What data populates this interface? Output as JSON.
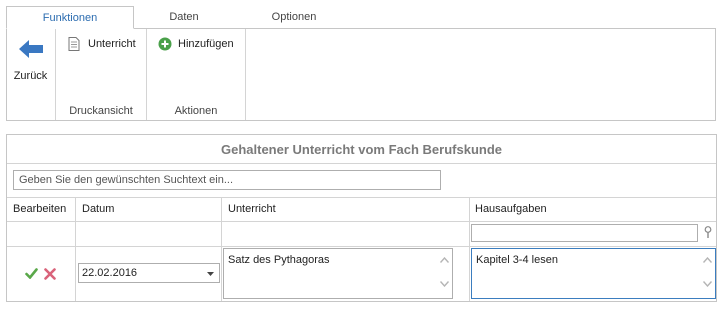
{
  "tabs": [
    {
      "label": "Funktionen",
      "active": true
    },
    {
      "label": "Daten",
      "active": false
    },
    {
      "label": "Optionen",
      "active": false
    }
  ],
  "ribbon": {
    "back_label": "Zurück",
    "print_group": {
      "button_label": "Unterricht",
      "group_label": "Druckansicht"
    },
    "actions_group": {
      "button_label": "Hinzufügen",
      "group_label": "Aktionen"
    }
  },
  "panel": {
    "title": "Gehaltener Unterricht vom Fach Berufskunde",
    "search_placeholder": "Geben Sie den gewünschten Suchtext ein...",
    "columns": [
      "Bearbeiten",
      "Datum",
      "Unterricht",
      "Hausaufgaben"
    ],
    "rows": [
      {
        "datum": "22.02.2016",
        "unterricht": "Satz des Pythagoras",
        "hausaufgaben": "Kapitel 3-4 lesen"
      }
    ]
  },
  "colors": {
    "accent": "#2b6cb0",
    "check": "#5aa84a",
    "delete": "#d9637a",
    "back_arrow": "#3a78c2",
    "add_icon": "#4aa04a"
  },
  "icons": [
    "back-arrow-icon",
    "document-icon",
    "plus-circle-icon",
    "filter-icon",
    "checkmark-icon",
    "delete-x-icon",
    "chevron-down-icon",
    "scroll-up-icon",
    "scroll-down-icon"
  ]
}
